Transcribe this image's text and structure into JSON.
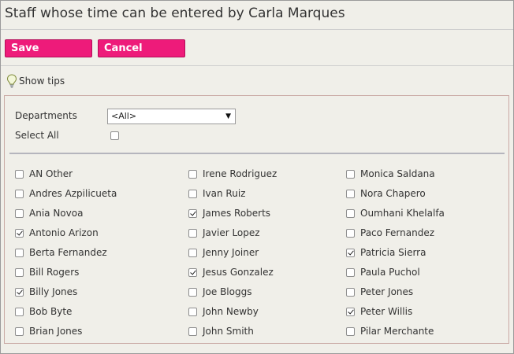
{
  "page": {
    "title": "Staff whose time can be entered by Carla Marques"
  },
  "toolbar": {
    "save_label": "Save",
    "cancel_label": "Cancel"
  },
  "tips": {
    "label": "Show tips",
    "icon": "lightbulb-icon"
  },
  "filters": {
    "departments_label": "Departments",
    "departments_value": "<All>",
    "select_all_label": "Select All",
    "select_all_checked": false
  },
  "colors": {
    "accent": "#ee1b7a",
    "panel_bg": "#f0efe9",
    "panel_border": "#c9a9a4"
  },
  "staff_columns": [
    [
      {
        "name": "AN Other",
        "checked": false
      },
      {
        "name": "Andres Azpilicueta",
        "checked": false
      },
      {
        "name": "Ania Novoa",
        "checked": false
      },
      {
        "name": "Antonio Arizon",
        "checked": true
      },
      {
        "name": "Berta Fernandez",
        "checked": false
      },
      {
        "name": "Bill Rogers",
        "checked": false
      },
      {
        "name": "Billy Jones",
        "checked": true
      },
      {
        "name": "Bob Byte",
        "checked": false
      },
      {
        "name": "Brian Jones",
        "checked": false
      }
    ],
    [
      {
        "name": "Irene Rodriguez",
        "checked": false
      },
      {
        "name": "Ivan Ruiz",
        "checked": false
      },
      {
        "name": "James Roberts",
        "checked": true
      },
      {
        "name": "Javier Lopez",
        "checked": false
      },
      {
        "name": "Jenny Joiner",
        "checked": false
      },
      {
        "name": "Jesus Gonzalez",
        "checked": true
      },
      {
        "name": "Joe Bloggs",
        "checked": false
      },
      {
        "name": "John Newby",
        "checked": false
      },
      {
        "name": "John Smith",
        "checked": false
      }
    ],
    [
      {
        "name": "Monica Saldana",
        "checked": false
      },
      {
        "name": "Nora Chapero",
        "checked": false
      },
      {
        "name": "Oumhani Khelalfa",
        "checked": false
      },
      {
        "name": "Paco Fernandez",
        "checked": false
      },
      {
        "name": "Patricia Sierra",
        "checked": true
      },
      {
        "name": "Paula Puchol",
        "checked": false
      },
      {
        "name": "Peter Jones",
        "checked": false
      },
      {
        "name": "Peter Willis",
        "checked": true
      },
      {
        "name": "Pilar Merchante",
        "checked": false
      }
    ]
  ]
}
